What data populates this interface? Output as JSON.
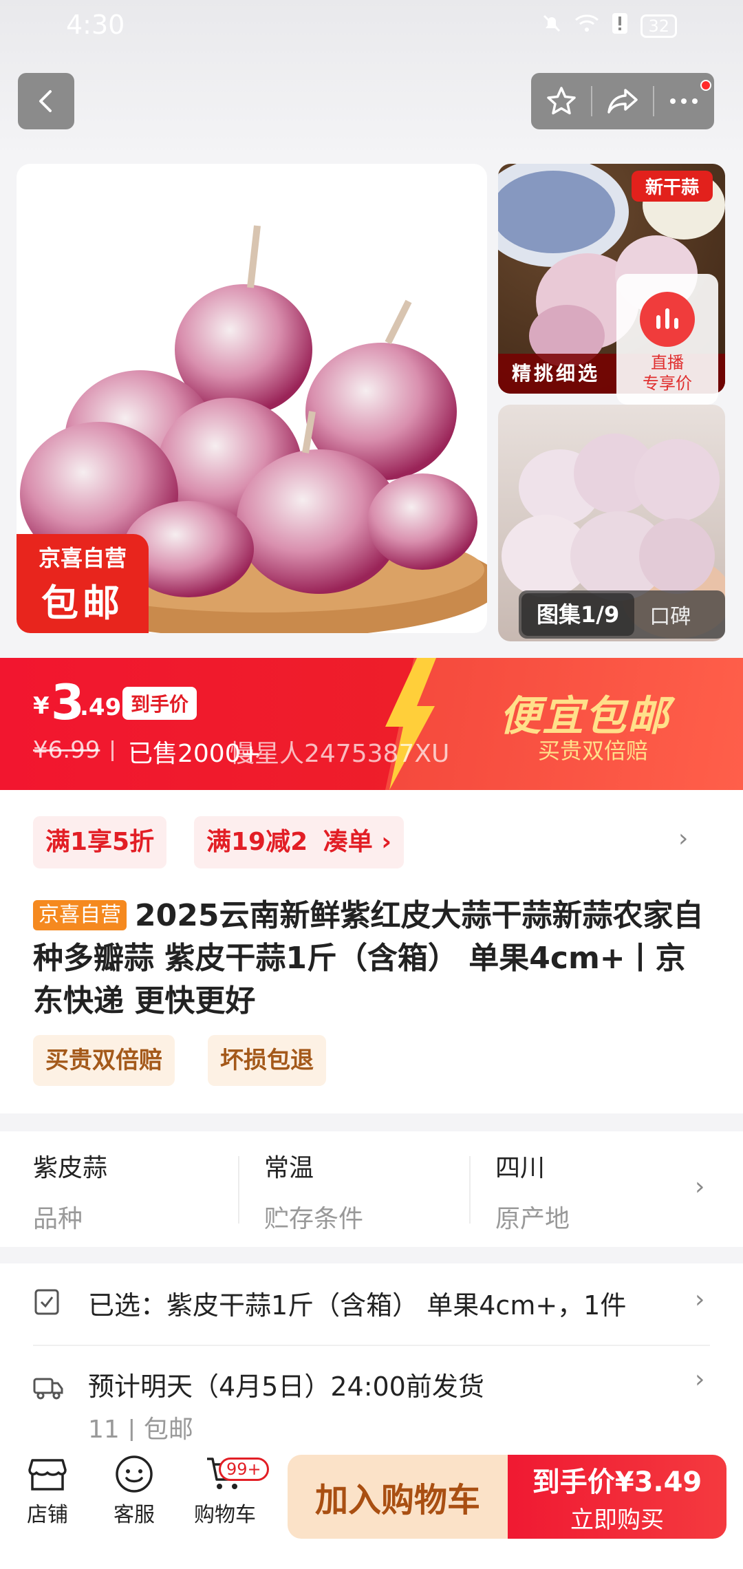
{
  "status_bar": {
    "time": "4:30",
    "battery": "32"
  },
  "gallery": {
    "thumb1_tag": "新干蒜",
    "thumb1_caption": "精挑细选",
    "live_label": "直播",
    "live_sub": "专享价",
    "counter": "图集1/9",
    "reviews": "口碑",
    "badge_line1": "京喜自营",
    "badge_line2": "包邮"
  },
  "price": {
    "currency": "¥",
    "integer": "3",
    "decimal": ".49",
    "tag": "到手价",
    "original": "¥6.99",
    "sold": "已售2000+",
    "overlay": "慢星人2475387XU",
    "banner_title": "便宜包邮",
    "banner_sub": "买贵双倍赔"
  },
  "promos": {
    "p1": "满1享5折",
    "p2": "满19减2",
    "p2_link": "凑单 ›"
  },
  "product": {
    "tag": "京喜自营",
    "title": "2025云南新鲜紫红皮大蒜干蒜新蒜农家自种多瓣蒜 紫皮干蒜1斤（含箱） 单果4cm+丨京东快递 更快更好",
    "services": [
      "买贵双倍赔",
      "坏损包退"
    ]
  },
  "specs": [
    {
      "value": "紫皮蒜",
      "key": "品种"
    },
    {
      "value": "常温",
      "key": "贮存条件"
    },
    {
      "value": "四川",
      "key": "原产地"
    }
  ],
  "selection": {
    "selected": "已选：紫皮干蒜1斤（含箱） 单果4cm+，1件",
    "shipping": "预计明天（4月5日）24:00前发货",
    "shipping_sub": "11 | 包邮"
  },
  "bottom_bar": {
    "shop": "店铺",
    "service": "客服",
    "cart": "购物车",
    "cart_badge": "99+",
    "add_cart": "加入购物车",
    "buy_price": "到手价¥3.49",
    "buy_now": "立即购买"
  },
  "colors": {
    "brand_red": "#f2162f",
    "promo_red": "#e21e25",
    "gold": "#ffe08a"
  }
}
